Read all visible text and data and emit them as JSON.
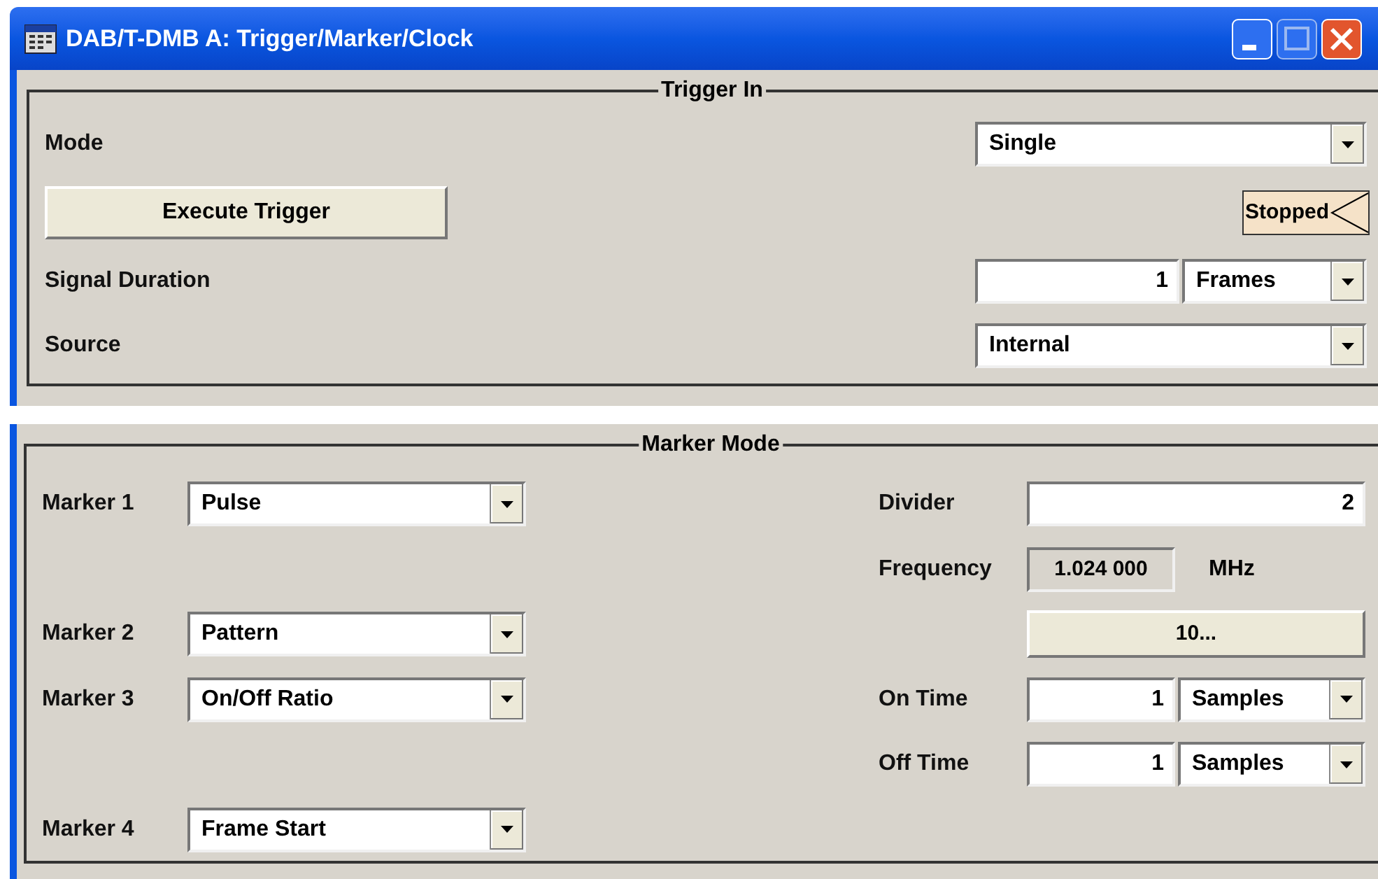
{
  "window": {
    "title": "DAB/T-DMB A: Trigger/Marker/Clock"
  },
  "trigger_in": {
    "title": "Trigger In",
    "rows": [
      {
        "kind": "select",
        "label": "Mode",
        "value": "Single"
      },
      {
        "kind": "execute",
        "button": "Execute Trigger",
        "status": "Stopped"
      },
      {
        "kind": "number_unit",
        "label": "Signal Duration",
        "value": "1",
        "unit": "Frames"
      },
      {
        "kind": "select",
        "label": "Source",
        "value": "Internal"
      }
    ]
  },
  "marker_mode": {
    "title": "Marker Mode",
    "rows": [
      {
        "marker": {
          "label": "Marker 1",
          "value": "Pulse"
        },
        "setting": {
          "kind": "number",
          "label": "Divider",
          "value": "2"
        }
      },
      {
        "setting": {
          "kind": "readout",
          "label": "Frequency",
          "value": "1.024 000",
          "unit": "MHz"
        }
      },
      {
        "marker": {
          "label": "Marker 2",
          "value": "Pattern"
        },
        "setting": {
          "kind": "button",
          "label": "10..."
        }
      },
      {
        "marker": {
          "label": "Marker 3",
          "value": "On/Off Ratio"
        },
        "setting": {
          "kind": "number_unit",
          "label": "On Time",
          "value": "1",
          "unit": "Samples"
        }
      },
      {
        "setting": {
          "kind": "number_unit",
          "label": "Off Time",
          "value": "1",
          "unit": "Samples"
        }
      },
      {
        "marker": {
          "label": "Marker 4",
          "value": "Frame Start"
        }
      }
    ]
  }
}
